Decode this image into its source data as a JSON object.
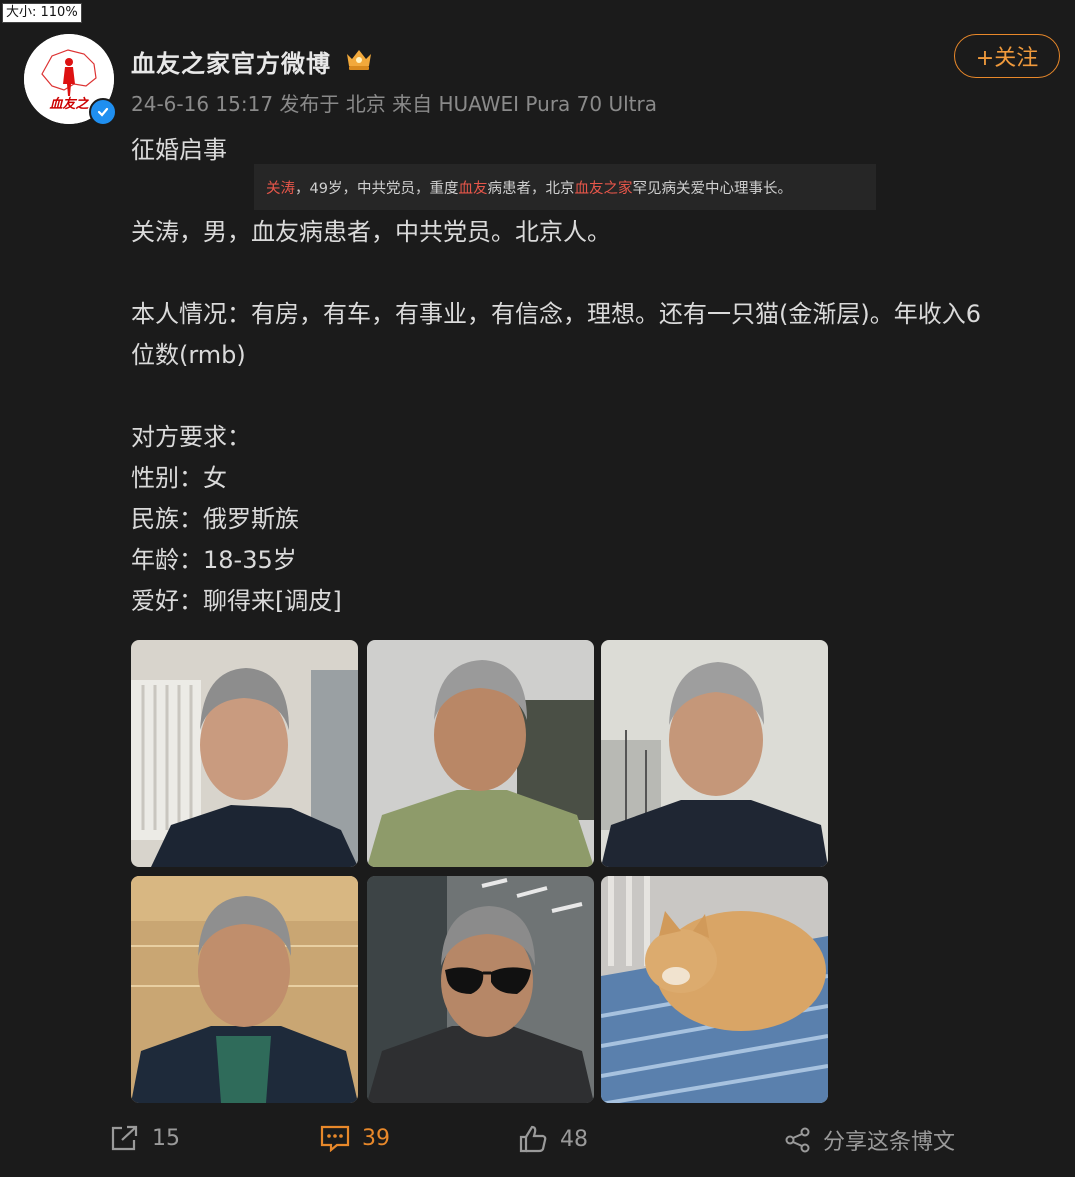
{
  "zoom_label": "大小: 110%",
  "author": {
    "name": "血友之家官方微博",
    "avatar_text": "血友之",
    "vip_badge": "crown-badge-icon"
  },
  "meta": {
    "timestamp": "24-6-16 15:17",
    "location": "发布于 北京",
    "device": "来自 HUAWEI Pura 70 Ultra"
  },
  "follow_label": "+关注",
  "post": {
    "title": "征婚启事",
    "line1": "关涛，男，血友病患者，中共党员。北京人。",
    "line2a": "本人情况：有房，有车，有事业，有信念，理想。还有一只猫(金渐层)。年收入6",
    "line2b": "位数(rmb)",
    "req_title": "对方要求：",
    "req_gender": "性别：女",
    "req_ethnicity": "民族：俄罗斯族",
    "req_age": "年龄：18-35岁",
    "req_hobby": "爱好：聊得来[调皮]"
  },
  "tooltip": {
    "name": "关涛",
    "part1": "，49岁，中共党员，重度",
    "hl1": "血友",
    "part2": "病患者，北京",
    "hl2": "血友之家",
    "part3": "罕见病关爱中心理事长。"
  },
  "actions": {
    "repost_count": "15",
    "comment_count": "39",
    "like_count": "48",
    "share_label": "分享这条博文"
  },
  "colors": {
    "background": "#1b1b1b",
    "accent": "#e8882a",
    "highlight": "#e6564a",
    "verified": "#1f8ff0"
  }
}
